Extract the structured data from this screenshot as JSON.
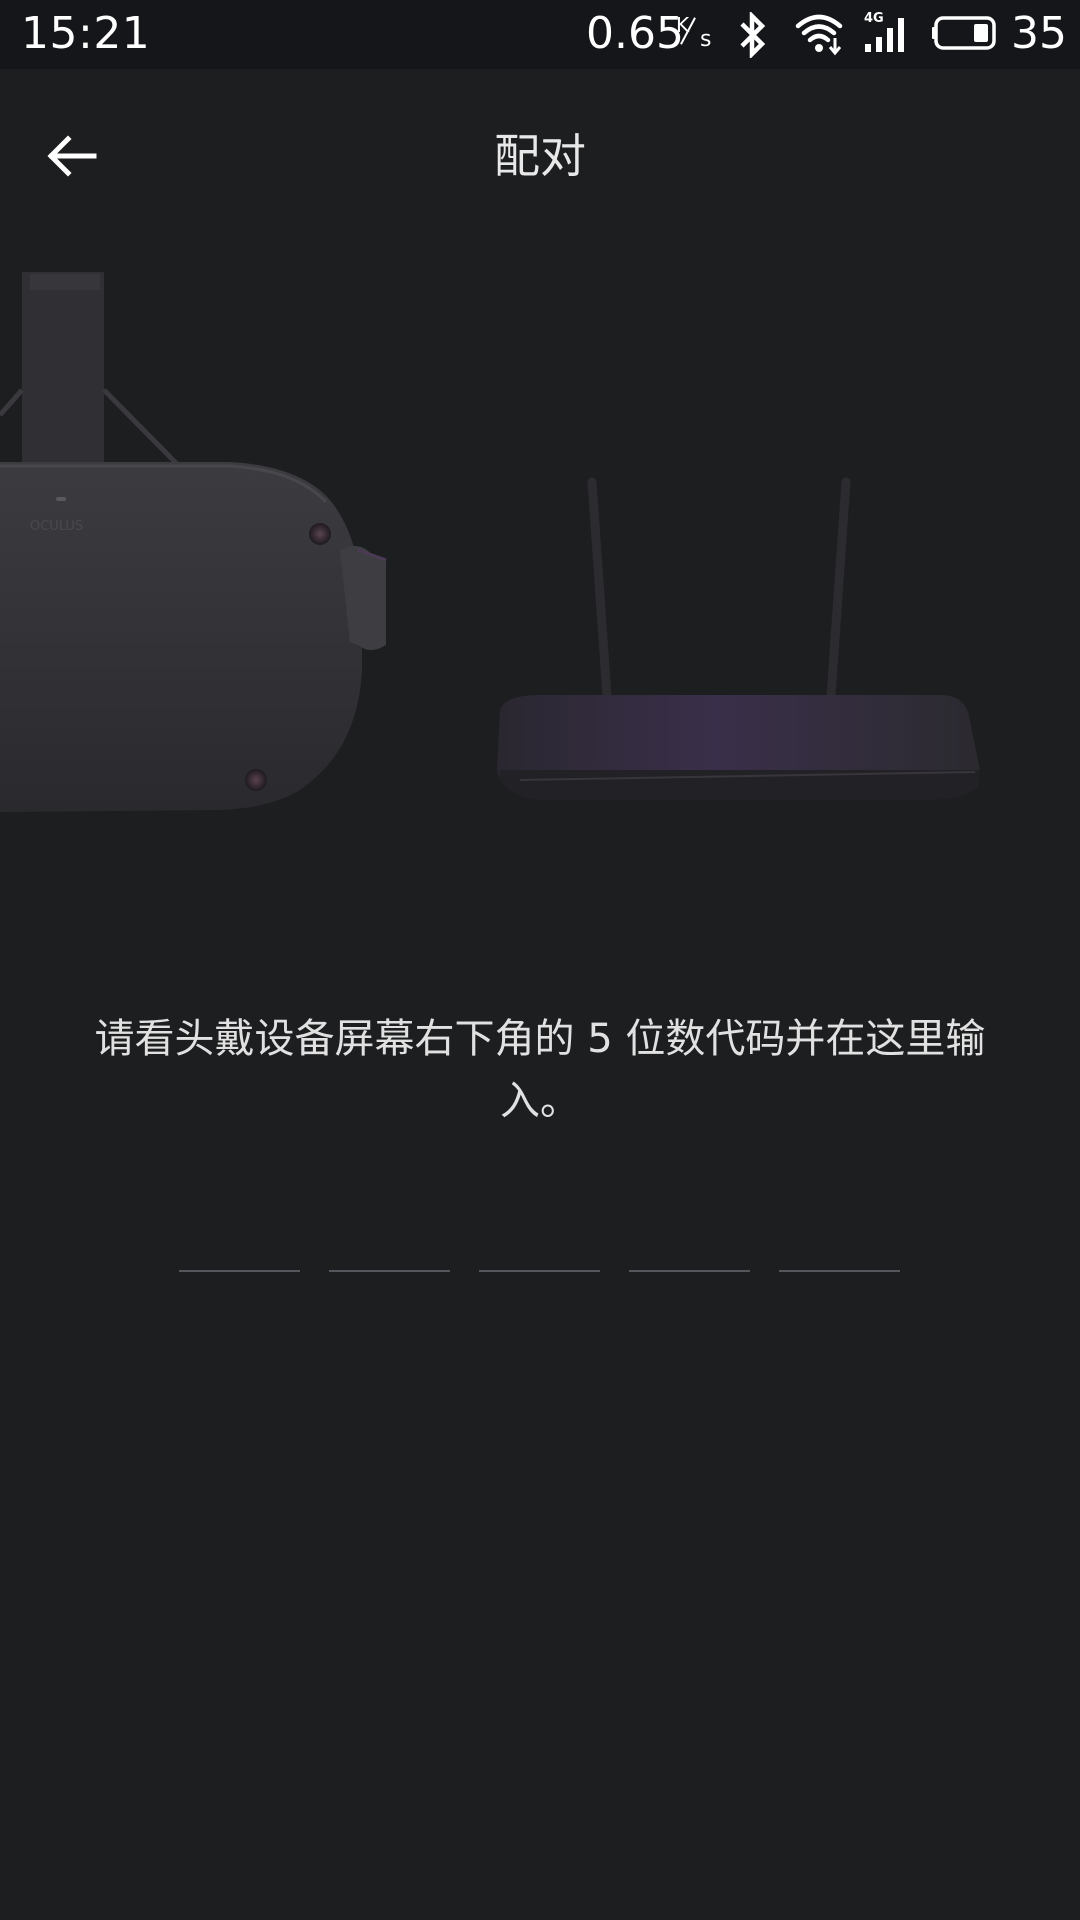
{
  "status_bar": {
    "time": "15:21",
    "net_speed": "0.65",
    "net_speed_unit_top": "K",
    "net_speed_unit_bottom": "s",
    "network_type": "4G",
    "battery_percent": "35",
    "icons": [
      "bluetooth-icon",
      "wifi-icon",
      "cellular-signal-icon",
      "battery-icon"
    ]
  },
  "app_bar": {
    "title": "配对",
    "back_icon": "arrow-left-icon"
  },
  "illustration": {
    "headset_brand": "OCULUS"
  },
  "instruction": {
    "text": "请看头戴设备屏幕右下角的 5 位数代码并在这里输入。"
  },
  "code_inputs": {
    "digits": [
      "",
      "",
      "",
      "",
      ""
    ]
  },
  "colors": {
    "background": "#1d1e20",
    "status_bar": "#15161a",
    "text": "#e1e1e1",
    "input_underline": "#55575c"
  }
}
